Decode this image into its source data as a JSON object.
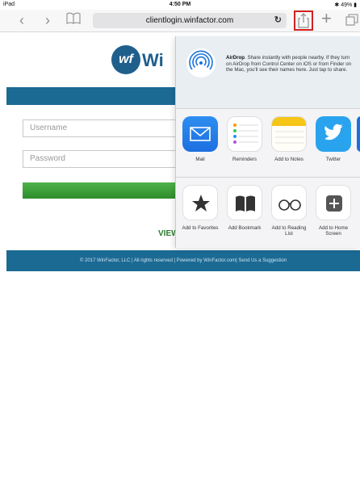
{
  "status_bar": {
    "device": "iPad",
    "time": "4:50 PM",
    "battery": "49%"
  },
  "browser": {
    "url": "clientlogin.winfactor.com",
    "back_glyph": "‹",
    "forward_glyph": "›",
    "new_tab_glyph": "+"
  },
  "page": {
    "logo_mark": "wf",
    "logo_text": "Wi",
    "username_placeholder": "Username",
    "password_placeholder": "Password",
    "view_link": "VIEW",
    "footer": "© 2017 WinFactor, LLC | All rights reserved | Powered by WinFactor.com| Send Us a Suggestion"
  },
  "share_sheet": {
    "airdrop": {
      "title": "AirDrop",
      "text": ". Share instantly with people nearby. If they turn on AirDrop from Control Center on iOS or from Finder on the Mac, you'll see their names here. Just tap to share."
    },
    "apps": [
      {
        "label": "Mail",
        "icon": "mail-icon"
      },
      {
        "label": "Reminders",
        "icon": "reminders-icon"
      },
      {
        "label": "Add to Notes",
        "icon": "notes-icon"
      },
      {
        "label": "Twitter",
        "icon": "twitter-icon"
      }
    ],
    "actions": [
      {
        "label": "Add to Favorites",
        "icon": "star-icon"
      },
      {
        "label": "Add Bookmark",
        "icon": "book-icon"
      },
      {
        "label": "Add to Reading List",
        "icon": "glasses-icon"
      },
      {
        "label": "Add to Home Screen",
        "icon": "plus-square-icon"
      }
    ]
  },
  "colors": {
    "brand_blue": "#1b6a94",
    "button_green": "#3ba036",
    "share_highlight": "#d32020"
  }
}
